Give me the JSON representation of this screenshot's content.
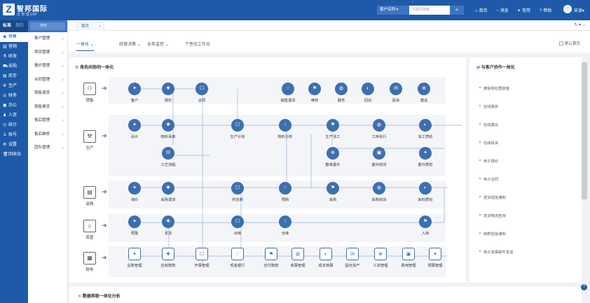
{
  "app": {
    "brand": "智邦国际",
    "brand_sub": "云 管 理 ERP"
  },
  "topbar": {
    "search_select": "客户名称",
    "search_placeholder": "关键词搜索",
    "nav": [
      {
        "label": "首页",
        "icon": "home-icon"
      },
      {
        "label": "消息",
        "icon": "bell-icon"
      },
      {
        "label": "常用",
        "icon": "star-icon"
      },
      {
        "label": "帮助",
        "icon": "help-icon"
      }
    ],
    "user": "宋波"
  },
  "sidebar": {
    "header": "标准",
    "header2": "我的",
    "items": [
      {
        "label": "销售",
        "icon": "sales-icon"
      },
      {
        "label": "营销",
        "icon": "chart-icon"
      },
      {
        "label": "研发",
        "icon": "flask-icon"
      },
      {
        "label": "采购",
        "icon": "cart-icon"
      },
      {
        "label": "库存",
        "icon": "box-icon"
      },
      {
        "label": "生产",
        "icon": "gear-icon"
      },
      {
        "label": "财务",
        "icon": "money-icon"
      },
      {
        "label": "办公",
        "icon": "briefcase-icon"
      },
      {
        "label": "人资",
        "icon": "person-icon"
      },
      {
        "label": "统计",
        "icon": "clock-icon"
      },
      {
        "label": "账号",
        "icon": "user-icon"
      },
      {
        "label": "设置",
        "icon": "settings-icon"
      },
      {
        "label": "回收站",
        "icon": "trash-icon"
      }
    ]
  },
  "submenu": {
    "search_placeholder": "搜索",
    "items": [
      "客户管理",
      "项目管理",
      "报价管理",
      "合同管理",
      "销售退货",
      "销售换货",
      "售后管理",
      "售后维修",
      "团队管理"
    ]
  },
  "tabs": {
    "home": "首页"
  },
  "main": {
    "tabs": [
      "一体化",
      "经营决策",
      "业务监控",
      "个性化工作台"
    ],
    "default_home": "默认首页",
    "section1": "角色间协同一体化",
    "section2": "与客户协作一体化",
    "section3": "数据串联一体化分析",
    "roles": [
      "销售",
      "生产",
      "采购",
      "库管",
      "财务"
    ],
    "nodes": {
      "sales": [
        "客户",
        "报价",
        "合同",
        "销售退货",
        "维修",
        "服务",
        "回访",
        "投诉",
        "建议"
      ],
      "prod": [
        "设计",
        "物料清单",
        "生产计划",
        "物料分析",
        "生产派工",
        "工序执行",
        "派工质检",
        "工艺流程",
        "整单委外",
        "委外收货",
        "委外质检"
      ],
      "purchase": [
        "询价",
        "采购退货",
        "供应商",
        "预购",
        "采购",
        "采购收货",
        "来料质检"
      ],
      "stock": [
        "预警",
        "发货",
        "出库",
        "仓库",
        "入库"
      ],
      "finance": [
        "总账管理",
        "应收账款",
        "开票管理",
        "现金银行",
        "应付账款",
        "收票管理",
        "成本核算",
        "固定资产",
        "工资管理",
        "费用管理",
        "预算管理"
      ]
    },
    "customer_list": [
      "微信和社群获客",
      "在线服务",
      "在线建议",
      "在线投诉",
      "电子报价",
      "电子合同",
      "发货短信通知",
      "发货物流查询",
      "到款短信通知",
      "电子发票邮件发送"
    ]
  }
}
